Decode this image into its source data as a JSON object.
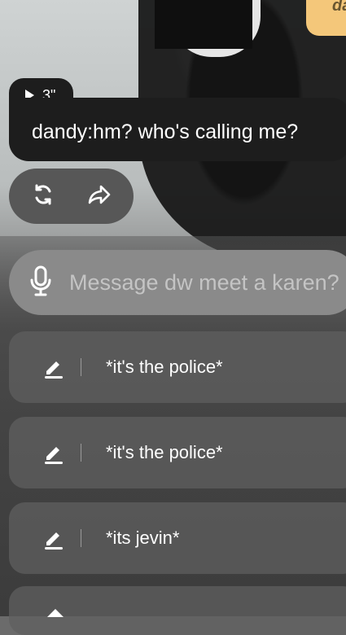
{
  "top_bubble": {
    "partial_text": "da"
  },
  "audio": {
    "duration": "3\""
  },
  "message": {
    "text": "dandy:hm? who's calling me?"
  },
  "actions": {
    "regenerate_icon": "refresh-icon",
    "share_icon": "share-icon"
  },
  "input": {
    "placeholder": "Message dw meet a karen?",
    "mic_icon": "microphone-icon"
  },
  "suggestions": [
    {
      "text": "*it's the police*",
      "icon": "edit-icon"
    },
    {
      "text": "*it's the police*",
      "icon": "edit-icon"
    },
    {
      "text": "*its jevin*",
      "icon": "edit-icon"
    }
  ],
  "colors": {
    "accent_bubble": "#f4c77a",
    "message_bg": "#1d1d1d",
    "input_bg": "#8a8a8a"
  }
}
